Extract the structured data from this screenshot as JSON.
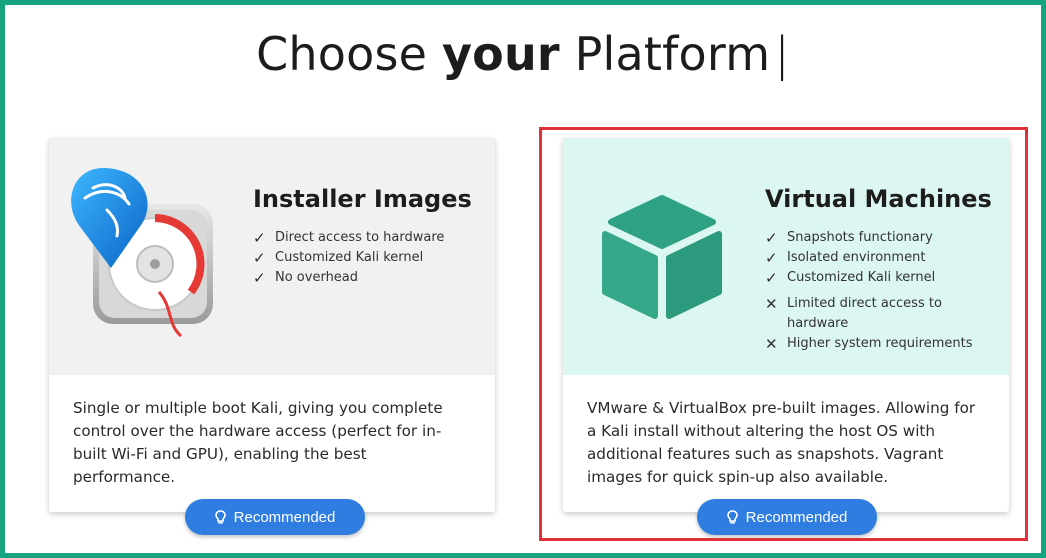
{
  "page": {
    "title_prefix": "Choose ",
    "title_bold": "your",
    "title_suffix": " Platform",
    "title_caret": "|"
  },
  "cards": [
    {
      "heading": "Installer Images",
      "features": [
        {
          "mark": "✓",
          "text": "Direct access to hardware"
        },
        {
          "mark": "✓",
          "text": "Customized Kali kernel"
        },
        {
          "mark": "✓",
          "text": "No overhead"
        }
      ],
      "description": "Single or multiple boot Kali, giving you complete control over the hardware access (perfect for in-built Wi-Fi and GPU), enabling the best performance.",
      "button_label": "Recommended",
      "icon": "installer-disc-icon"
    },
    {
      "heading": "Virtual Machines",
      "features": [
        {
          "mark": "✓",
          "text": "Snapshots functionary"
        },
        {
          "mark": "✓",
          "text": "Isolated environment"
        },
        {
          "mark": "✓",
          "text": "Customized Kali kernel"
        },
        {
          "mark": "✕",
          "text": "Limited direct access to hardware"
        },
        {
          "mark": "✕",
          "text": "Higher system requirements"
        }
      ],
      "description": "VMware & VirtualBox pre-built images. Allowing for a Kali install without altering the host OS with additional features such as snapshots. Vagrant images for quick spin-up also available.",
      "button_label": "Recommended",
      "icon": "virtual-cube-icon"
    }
  ],
  "colors": {
    "frame": "#16a37f",
    "highlight": "#e0313a",
    "button": "#2f7de0",
    "vm_bg": "#dcf6f1",
    "cube": "#2fa184"
  }
}
